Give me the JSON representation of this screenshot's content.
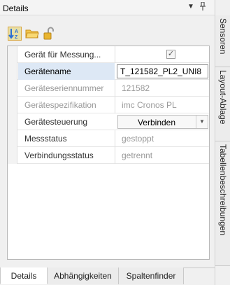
{
  "panel": {
    "title": "Details",
    "dropdown_glyph": "▼",
    "pin_glyph": "ᛘ"
  },
  "toolbar": {
    "tools": [
      {
        "icon": "sort-az-icon"
      },
      {
        "icon": "folder-icon"
      },
      {
        "icon": "lock-open-icon"
      }
    ]
  },
  "grid": {
    "rows": [
      {
        "name": "Gerät für Messung...",
        "value_type": "checkbox",
        "checked": true
      },
      {
        "name": "Gerätename",
        "value": "T_121582_PL2_UNI8",
        "value_type": "text-input",
        "selected": true
      },
      {
        "name": "Geräteseriennummer",
        "value": "121582",
        "value_type": "readonly"
      },
      {
        "name": "Gerätespezifikation",
        "value": "imc Cronos PL",
        "value_type": "readonly"
      },
      {
        "name": "Gerätesteuerung",
        "value": "Verbinden",
        "value_type": "dropdown-button"
      },
      {
        "name": "Messstatus",
        "value": "gestoppt",
        "value_type": "readonly"
      },
      {
        "name": "Verbindungsstatus",
        "value": "getrennt",
        "value_type": "readonly"
      }
    ]
  },
  "bottom_tabs": [
    {
      "label": "Details",
      "active": true
    },
    {
      "label": "Abhängigkeiten",
      "active": false
    },
    {
      "label": "Spaltenfinder",
      "active": false
    }
  ],
  "side_tabs": [
    {
      "label": "Sensoren"
    },
    {
      "label": "Layout-Ablage"
    },
    {
      "label": "Tabellenbeschreibungen"
    }
  ],
  "colors": {
    "accent_selection": "#dde8f5",
    "sort_icon_blue": "#2a6fd6",
    "folder_yellow": "#e8b730",
    "lock_gold": "#d9a321"
  }
}
